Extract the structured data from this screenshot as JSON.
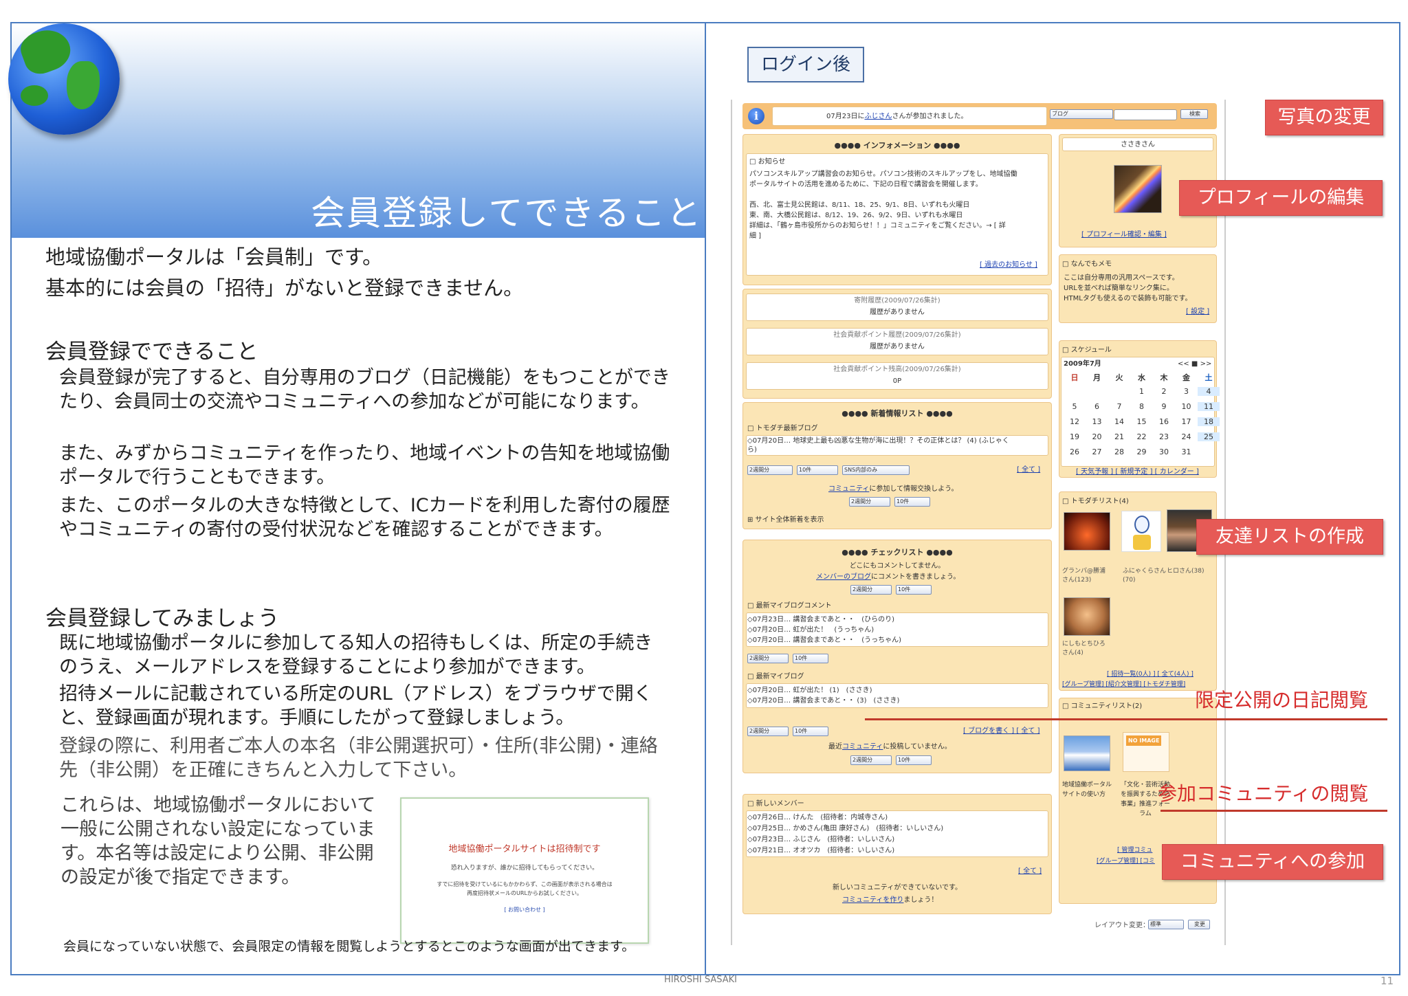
{
  "slide": {
    "title": "会員登録してできること",
    "intro_lines": [
      "地域協働ポータルは「会員制」です。",
      "基本的には会員の「招待」がないと登録できません。"
    ],
    "section1_heading": "会員登録でできること",
    "section1_paragraphs": [
      "会員登録が完了すると、自分専用のブログ（日記機能）をもつことができたり、会員同士の交流やコミュニティへの参加などが可能になります。",
      "また、みずからコミュニティを作ったり、地域イベントの告知を地域協働ポータルで行うこともできます。",
      "また、このポータルの大きな特徴として、ICカードを利用した寄付の履歴やコミュニティの寄付の受付状況などを確認することができます。"
    ],
    "section2_heading": "会員登録してみましょう",
    "section2_paragraphs": [
      "既に地域協働ポータルに参加してる知人の招待もしくは、所定の手続きのうえ、メールアドレスを登録することにより参加ができます。",
      "招待メールに記載されている所定のURL（アドレス）をブラウザで開くと、登録画面が現れます。手順にしたがって登録しましょう。",
      "登録の際に、利用者ご本人の本名（非公開選択可）・住所(非公開)・連絡先（非公開）を正確にきちんと入力して下さい。"
    ],
    "note": "これらは、地域協働ポータルにおいて一般に公開されない設定になっています。本名等は設定により公開、非公開の設定が後で指定できます。",
    "thumb": {
      "title": "地域協働ポータルサイトは招待制です",
      "line1": "恐れ入りますが、誰かに招待してもらってください。",
      "line2": "すでに招待を受けているにもかかわらず、この画面が表示される場合は",
      "line3": "再度招待状メールのURLからお試しください。",
      "link": "[ お問い合わせ ]"
    },
    "caption": "会員になっていない状態で、会員限定の情報を閲覧しようとするとこのような画面が出てきます。",
    "footer": "HIROSHI SASAKI",
    "page_number": "11"
  },
  "right": {
    "login_label": "ログイン後",
    "callouts": {
      "photo_change": "写真の変更",
      "profile_edit": "プロフィールの編集",
      "friend_list": "友達リストの作成",
      "private_diary": "限定公開の日記閲覧",
      "community_view": "参加コミュニティの閲覧",
      "community_join": "コミュニティへの参加"
    },
    "screenshot": {
      "top_notice_pre": "07月23日に",
      "top_notice_user": "ふじさん",
      "top_notice_post": "さんが参加されました。",
      "search_select": "ブログ",
      "search_button": "検索",
      "info_title": "●●●● インフォメーション ●●●●",
      "info_heading": "□ お知らせ",
      "info_lines": [
        "パソコンスキルアップ講習会のお知らせ。パソコン技術のスキルアップをし、地域協働",
        "ポータルサイトの活用を進めるために、下記の日程で講習会を開催します。",
        "",
        "西、北、富士見公民館は、8/11、18、25、9/1、8日、いずれも火曜日",
        "東、南、大橋公民館は、8/12、19、26、9/2、9日、いずれも水曜日",
        "詳細は、「鶴ヶ島市役所からのお知らせ！！」コミュニティをご覧ください。→ [ 詳",
        "細 ]"
      ],
      "past_news": "[ 過去のお知らせ ]",
      "donation1_title": "寄附履歴(2009/07/26集計)",
      "donation1_value": "履歴がありません",
      "donation2_title": "社会貢献ポイント履歴(2009/07/26集計)",
      "donation2_value": "履歴がありません",
      "donation3_title": "社会貢献ポイント残高(2009/07/26集計)",
      "donation3_value": "0P",
      "newinfo_title": "●●●● 新着情報リスト ●●●●",
      "tomodachi_blog": "□ トモダチ最新ブログ",
      "tomodachi_blog_item": "◇07月20日… 地球史上最も凶悪な生物が海に出現！？その正体とは？ (4) (ふじゃく",
      "tomodachi_blog_item2": "ら)",
      "all_link": "[ 全て ]",
      "sel_period": "2週間分",
      "sel_count": "10件",
      "sel_sns": "SNS内部のみ",
      "community_join_msg_link": "コミュニティ",
      "community_join_msg": "に参加して情報交換しよう。",
      "site_all_new": "⊞ サイト全体新着を表示",
      "checklist_title": "●●●● チェックリスト ●●●●",
      "no_comment": "どこにもコメントしてません。",
      "member_blog_link": "メンバーのブログ",
      "member_blog_msg": "にコメントを書きましょう。",
      "my_blog_comment": "□ 最新マイブログコメント",
      "comment_items": [
        "◇07月23日… 講習会まであと・・　(ひらのり)",
        "◇07月20日… 虹が出た！　(うっちゃん)",
        "◇07月20日… 講習会まであと・・　(うっちゃん)"
      ],
      "my_blog": "□ 最新マイブログ",
      "my_blog_items": [
        "◇07月20日… 虹が出た！ (1)　(ささき)",
        "◇07月20日… 講習会まであと・・ (3)　(ささき)"
      ],
      "write_blog": "[ ブログを書く ] [ 全て ]",
      "recent_comm": "最近",
      "recent_comm_link": "コミュニティ",
      "recent_comm_post": "に投稿していません。",
      "new_members": "□ 新しいメンバー",
      "member_items": [
        "◇07月26日… けんた　(招待者：内城寺さん)",
        "◇07月25日… かめさん(亀田 康好さん)　(招待者：いしいさん)",
        "◇07月23日… ふじさん　(招待者：いしいさん)",
        "◇07月21日… オオツカ　(招待者：いしいさん)"
      ],
      "no_community": "新しいコミュニティができていないです。",
      "make_community_link": "コミュニティを作り",
      "make_community_post": "ましょう！",
      "layout_change": "レイアウト変更：",
      "layout_select": "標準",
      "layout_button": "変更",
      "profile_name": "ささきさん",
      "profile_links": "[ プロフィール確認・編集 ]",
      "memo_heading": "□ なんでもメモ",
      "memo_lines": [
        "ここは自分専用の汎用スペースです。",
        "URLを並べれば簡単なリンク集に。",
        "HTMLタグも使えるので装飾も可能です。"
      ],
      "memo_setting": "[ 設定 ]",
      "schedule_heading": "□ スケジュール",
      "cal_month": "2009年7月",
      "cal_nav": "<< ■ >>",
      "cal_weekdays": [
        "日",
        "月",
        "火",
        "水",
        "木",
        "金",
        "土"
      ],
      "cal_rows": [
        [
          "",
          "",
          "",
          "1",
          "2",
          "3",
          "4"
        ],
        [
          "5",
          "6",
          "7",
          "8",
          "9",
          "10",
          "11"
        ],
        [
          "12",
          "13",
          "14",
          "15",
          "16",
          "17",
          "18"
        ],
        [
          "19",
          "20",
          "21",
          "22",
          "23",
          "24",
          "25"
        ],
        [
          "26",
          "27",
          "28",
          "29",
          "30",
          "31",
          ""
        ]
      ],
      "cal_links": "[ 天気予報 ] [ 新規予定 ] [ カレンダー ]",
      "friend_heading": "□ トモダチリスト(4)",
      "friends": [
        "グランパ@勝浦さん(123)",
        "ふにゃくらさん(70)",
        "ヒロさん(38)",
        "にしもとちひろさん(4)"
      ],
      "friend_links1": "[ 招待一覧(0人) ] [ 全て(4人) ]",
      "friend_links2": "[グループ管理] [紹介文管理] [トモダチ管理]",
      "community_heading": "□ コミュニティリスト(2)",
      "no_image": "NO IMAGE",
      "community1": "地域協働ポータルサイトの使い方",
      "community2": "「文化・芸術活動を振興するための事業」推進フォーラム",
      "community_links1": "[ 管理コミュ",
      "community_links2": "[グループ管理] [コミ"
    }
  }
}
